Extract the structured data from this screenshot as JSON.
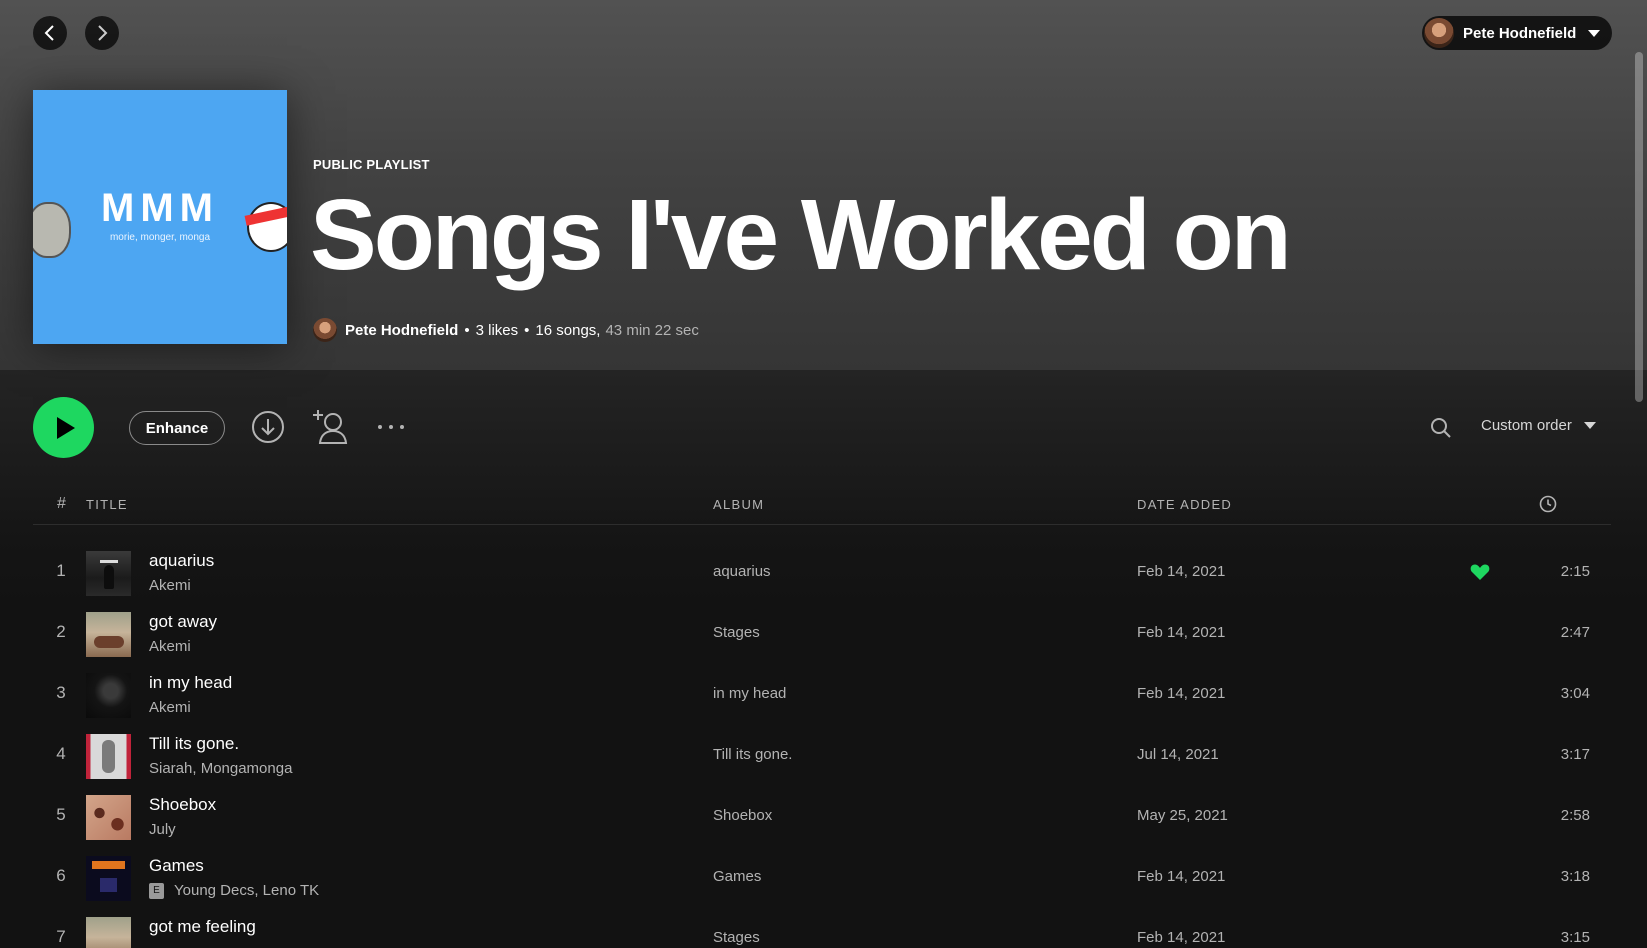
{
  "user": {
    "name": "Pete Hodnefield"
  },
  "cover": {
    "title": "MMM",
    "subtitle": "morie, monger, monga"
  },
  "playlist": {
    "type_label": "PUBLIC PLAYLIST",
    "title": "Songs I've Worked on",
    "owner": "Pete Hodnefield",
    "likes": "3 likes",
    "songs": "16 songs,",
    "duration": "43 min 22 sec"
  },
  "actions": {
    "enhance_label": "Enhance",
    "sort_label": "Custom order"
  },
  "table": {
    "headers": {
      "num": "#",
      "title": "Title",
      "album": "Album",
      "date": "Date added"
    },
    "rows": [
      {
        "num": "1",
        "title": "aquarius",
        "artist": "Akemi",
        "album": "aquarius",
        "date": "Feb 14, 2021",
        "duration": "2:15",
        "liked": true,
        "explicit": false
      },
      {
        "num": "2",
        "title": "got away",
        "artist": "Akemi",
        "album": "Stages",
        "date": "Feb 14, 2021",
        "duration": "2:47",
        "liked": false,
        "explicit": false
      },
      {
        "num": "3",
        "title": "in my head",
        "artist": "Akemi",
        "album": "in my head",
        "date": "Feb 14, 2021",
        "duration": "3:04",
        "liked": false,
        "explicit": false
      },
      {
        "num": "4",
        "title": "Till its gone.",
        "artist": "Siarah, Mongamonga",
        "album": "Till its gone.",
        "date": "Jul 14, 2021",
        "duration": "3:17",
        "liked": false,
        "explicit": false
      },
      {
        "num": "5",
        "title": "Shoebox",
        "artist": "July",
        "album": "Shoebox",
        "date": "May 25, 2021",
        "duration": "2:58",
        "liked": false,
        "explicit": false
      },
      {
        "num": "6",
        "title": "Games",
        "artist": "Young Decs, Leno TK",
        "album": "Games",
        "date": "Feb 14, 2021",
        "duration": "3:18",
        "liked": false,
        "explicit": true,
        "explicit_label": "E"
      },
      {
        "num": "7",
        "title": "got me feeling",
        "artist": "",
        "album": "Stages",
        "date": "Feb 14, 2021",
        "duration": "3:15",
        "liked": false,
        "explicit": false
      }
    ]
  },
  "colors": {
    "accent": "#1ed760",
    "cover_bg": "#4da6f2",
    "background": "#121212"
  },
  "icons": [
    "chevron-left-icon",
    "chevron-right-icon",
    "caret-down-icon",
    "play-icon",
    "download-icon",
    "add-user-icon",
    "more-icon",
    "search-icon",
    "clock-icon",
    "heart-icon"
  ]
}
